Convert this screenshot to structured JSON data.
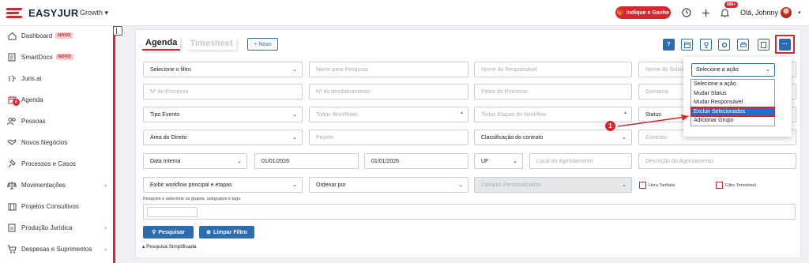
{
  "header": {
    "brand": "EASYJUR",
    "plan": "Growth",
    "indique_label": "Indique e Ganhe",
    "notif_badge": "999+",
    "greeting": "Olá, Johnny"
  },
  "sidebar": {
    "items": [
      {
        "label": "Dashboard",
        "tag": "NOVO",
        "icon": "home-icon"
      },
      {
        "label": "SmartDocs",
        "tag": "NOVO",
        "icon": "document-icon"
      },
      {
        "label": "Juris.ai",
        "icon": "ai-icon"
      },
      {
        "label": "Agenda",
        "icon": "calendar-icon",
        "count": "6"
      },
      {
        "label": "Pessoas",
        "icon": "people-icon"
      },
      {
        "label": "Novos Negócios",
        "icon": "handshake-icon"
      },
      {
        "label": "Processos e Casos",
        "icon": "gavel-icon"
      },
      {
        "label": "Movimentações",
        "icon": "scale-icon"
      },
      {
        "label": "Projetos Consultivos",
        "icon": "building-icon"
      },
      {
        "label": "Produção Jurídica",
        "icon": "file-icon"
      },
      {
        "label": "Despesas e Suprimentos",
        "icon": "cart-icon"
      }
    ]
  },
  "main": {
    "tabs": [
      "Agenda",
      "Timesheet"
    ],
    "new_button": "+ Novo",
    "toolbar_icons": [
      "help-icon",
      "calendar-icon",
      "trophy-icon",
      "settings-icon",
      "print-icon",
      "pdf-icon",
      "more-icon"
    ],
    "filters": {
      "select_filter": "Selecione o filtro",
      "search_name_ph": "Nome para Pesquisa",
      "responsible_ph": "Nome do Responsável",
      "requester_ph": "Nome do Solicitante",
      "process_ph": "Nº do Processo",
      "split_ph": "Nº do desdobramento",
      "folder_ph": "Pasta do Processo",
      "county_ph": "Comarca",
      "event_type": "Tipo Evento",
      "workflows_ph": "Todos Workflows",
      "workflow_steps_ph": "Todas Etapas do Workflow",
      "status": "Status",
      "law_area": "Área do Direito",
      "project_ph": "Projeto",
      "contract_class": "Classificação do contrato",
      "contract_ph": "Contrato",
      "date_type": "Data Interna",
      "date_from": "01/01/2026",
      "date_to": "01/01/2026",
      "uf": "UF",
      "schedule_place_ph": "Local do Agendamento",
      "schedule_desc_ph": "Descrição do Agendamento",
      "workflow_display": "Exibir workflow principal e etapas",
      "order_by": "Ordenar por",
      "custom_fields": "Campos Personalizados",
      "billed_hour": "Hora Tarifada",
      "timesheet_filter": "Filtro Timesheet"
    },
    "tags_hint": "Pesquise e selecione os grupos, subgrupos e tags:",
    "search_button": "Pesquisar",
    "clear_button": "Limpar Filtro",
    "simple_search": "Pesquisa Simplificada"
  },
  "action_popup": {
    "selected": "Selecione a ação",
    "options": [
      "Selecione a ação",
      "Mudar Status",
      "Mudar Responsável",
      "Excluir Selecionados",
      "Adicionar Grupo"
    ],
    "highlighted_index": 3
  },
  "annotation": {
    "step": "1"
  },
  "colors": {
    "brand_red": "#d7262d",
    "primary_blue": "#2d6cae",
    "select_blue": "#1f6fd1"
  }
}
